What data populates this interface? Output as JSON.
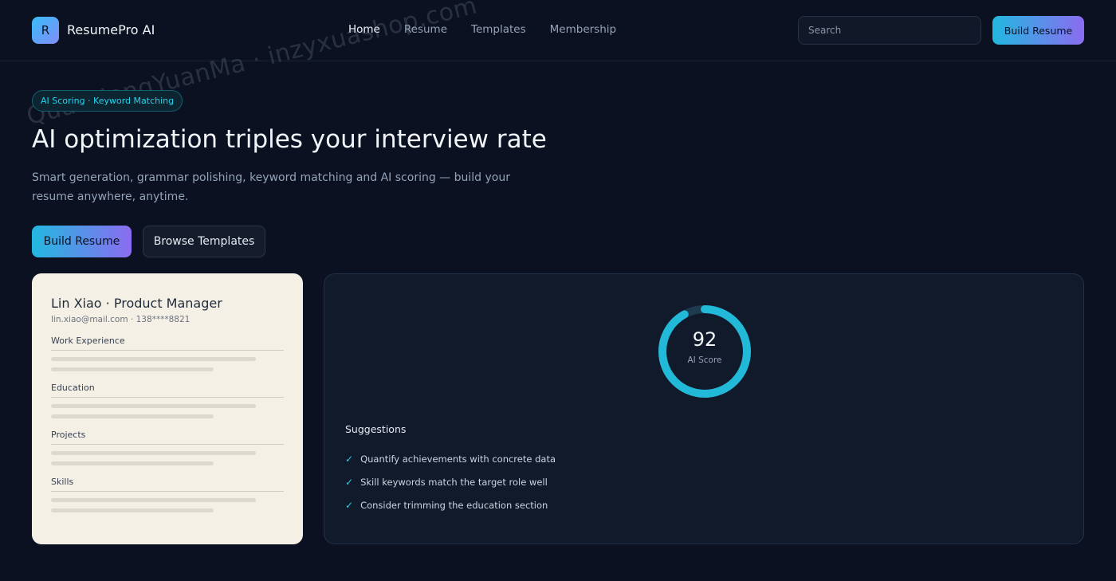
{
  "brand": {
    "initial": "R",
    "name": "ResumePro AI",
    "accent": "#22d3ee"
  },
  "nav": {
    "items": [
      "Home",
      "Resume",
      "Templates",
      "Membership"
    ],
    "active": "Home"
  },
  "search": {
    "placeholder": "Search"
  },
  "header": {
    "build_label": "Build Resume"
  },
  "watermark": "QuanNengYuanMa · inzyxuashop.com",
  "hero": {
    "tag": "AI Scoring · Keyword Matching",
    "title": "AI optimization triples your interview rate",
    "subtitle": "Smart generation, grammar polishing, keyword matching and AI scoring — build your resume anywhere, anytime.",
    "primary_label": "Build Resume",
    "secondary_label": "Browse Templates"
  },
  "resume_preview": {
    "name": "Lin Xiao · Product Manager",
    "contact": "lin.xiao@mail.com · 138****8821",
    "sections": [
      "Work Experience",
      "Education",
      "Projects",
      "Skills"
    ]
  },
  "score": {
    "value": "92",
    "fraction": 0.92,
    "label": "AI Score",
    "ring_color": "#22b8d8",
    "track_color": "#1e3a4f"
  },
  "suggestions": {
    "title": "Suggestions",
    "items": [
      "Quantify achievements with concrete data",
      "Skill keywords match the target role well",
      "Consider trimming the education section"
    ]
  },
  "icons": {
    "check": "check-icon"
  }
}
